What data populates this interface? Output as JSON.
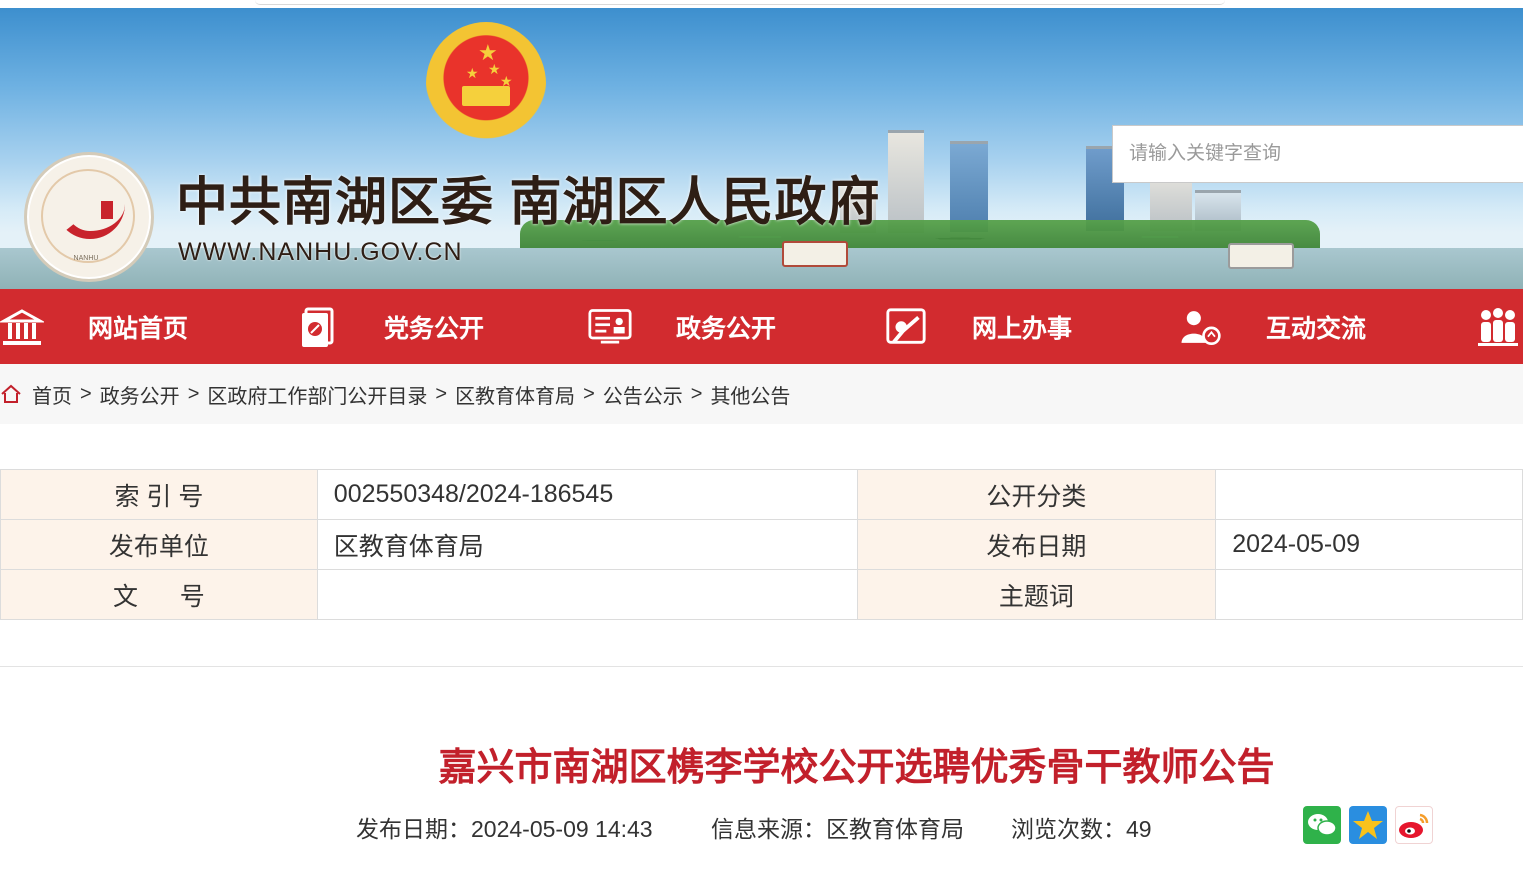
{
  "header": {
    "site_title": "中共南湖区委  南湖区人民政府",
    "site_url": "WWW.NANHU.GOV.CN",
    "logo_caption": "NANHU",
    "search_placeholder": "请输入关键字查询"
  },
  "nav": {
    "items": [
      {
        "label": "网站首页",
        "icon": "building-icon"
      },
      {
        "label": "党务公开",
        "icon": "party-document-icon"
      },
      {
        "label": "政务公开",
        "icon": "government-board-icon"
      },
      {
        "label": "网上办事",
        "icon": "online-service-icon"
      },
      {
        "label": "互动交流",
        "icon": "interaction-icon"
      },
      {
        "label": "",
        "icon": "people-group-icon"
      }
    ]
  },
  "breadcrumb": {
    "items": [
      "首页",
      "政务公开",
      "区政府工作部门公开目录",
      "区教育体育局",
      "公告公示",
      "其他公告"
    ],
    "separator": ">"
  },
  "info": {
    "rows": [
      {
        "k1": "索 引 号",
        "v1": "002550348/2024-186545",
        "k2": "公开分类",
        "v2": ""
      },
      {
        "k1": "发布单位",
        "v1": "区教育体育局",
        "k2": "发布日期",
        "v2": "2024-05-09"
      },
      {
        "k1": "文      号",
        "v1": "",
        "k2": "主题词",
        "v2": ""
      }
    ]
  },
  "article": {
    "title": "嘉兴市南湖区槜李学校公开选聘优秀骨干教师公告",
    "publish_date": "发布日期：2024-05-09 14:43",
    "source": "信息来源：区教育体育局",
    "views": "浏览次数：49"
  },
  "share": [
    "wechat-icon",
    "qzone-star-icon",
    "weibo-icon"
  ],
  "colors": {
    "nav_red": "#d22b2f",
    "title_red": "#c2202b",
    "table_key_bg": "#fdf3ea"
  }
}
